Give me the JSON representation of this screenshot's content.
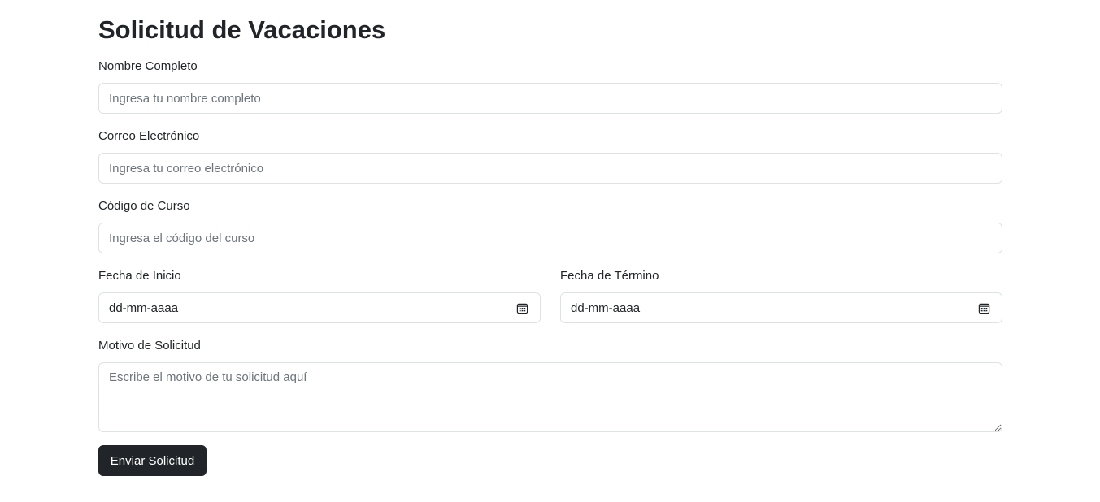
{
  "form": {
    "title": "Solicitud de Vacaciones",
    "full_name": {
      "label": "Nombre Completo",
      "placeholder": "Ingresa tu nombre completo",
      "value": ""
    },
    "email": {
      "label": "Correo Electrónico",
      "placeholder": "Ingresa tu correo electrónico",
      "value": ""
    },
    "course_code": {
      "label": "Código de Curso",
      "placeholder": "Ingresa el código del curso",
      "value": ""
    },
    "start_date": {
      "label": "Fecha de Inicio",
      "display": "dd-mm-aaaa",
      "icon": "calendar-icon"
    },
    "end_date": {
      "label": "Fecha de Término",
      "display": "dd-mm-aaaa",
      "icon": "calendar-icon"
    },
    "reason": {
      "label": "Motivo de Solicitud",
      "placeholder": "Escribe el motivo de tu solicitud aquí",
      "value": ""
    },
    "submit_label": "Enviar Solicitud"
  },
  "colors": {
    "text": "#212529",
    "placeholder": "#6c757d",
    "border": "#dee2e6",
    "button_bg": "#212529",
    "button_text": "#ffffff"
  }
}
